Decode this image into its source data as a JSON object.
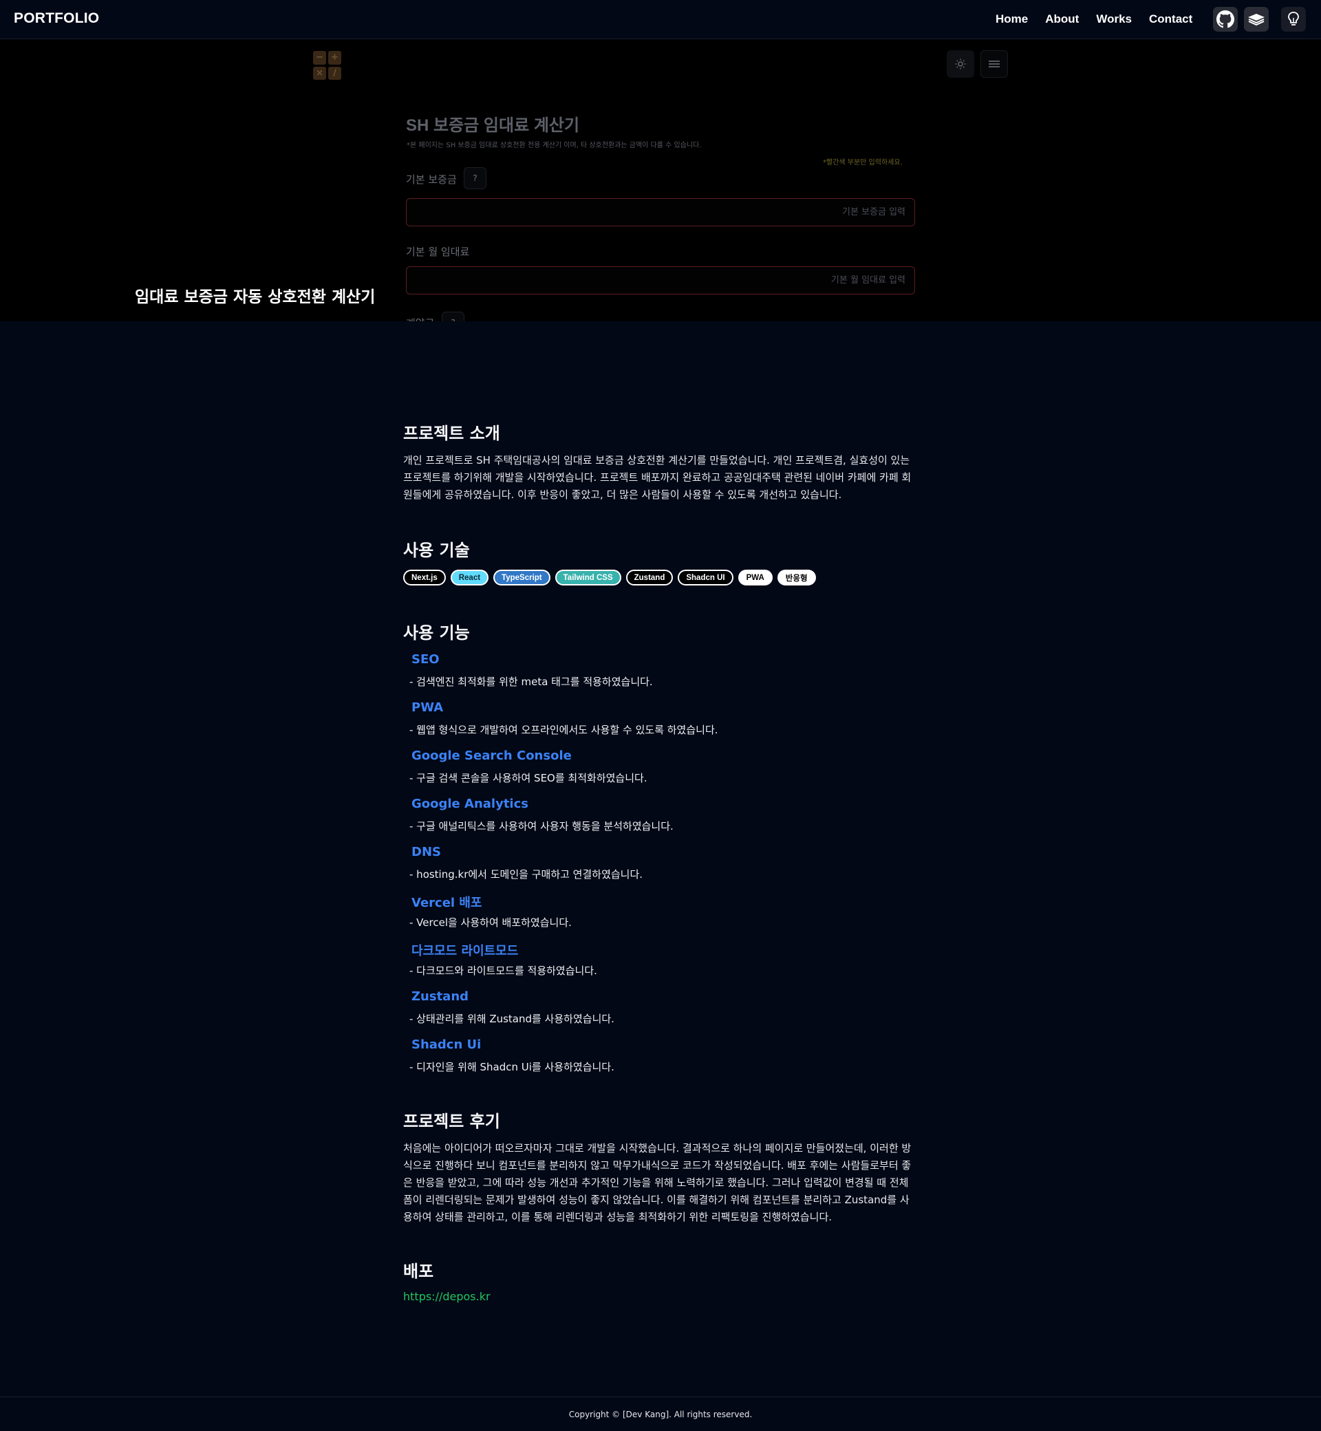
{
  "nav": {
    "logo": "PORTFOLIO",
    "links": [
      "Home",
      "About",
      "Works",
      "Contact"
    ],
    "icons": [
      "github-icon",
      "book-icon",
      "lightbulb-icon"
    ]
  },
  "hero": {
    "title": "임대료 보증금 자동 상호전환 계산기",
    "calc": {
      "title": "SH 보증금 임대료 계산기",
      "note": "*본 페이지는 SH 보증금 임대료 상호전환 전용 계산기 이며, 타 상호전환과는 금액이 다를 수 있습니다.",
      "red_note": "*빨간색 부분만 입력하세요.",
      "deposit_label": "기본 보증금",
      "deposit_help": "?",
      "deposit_placeholder": "기본 보증금 입력",
      "rent_label": "기본 월 임대료",
      "rent_placeholder": "기본 월 임대료 입력",
      "contract_label": "계약금",
      "contract_help": "?"
    }
  },
  "intro": {
    "heading": "프로젝트 소개",
    "text": "개인 프로젝트로 SH 주택임대공사의 임대료 보증금 상호전환 계산기를 만들었습니다. 개인 프로젝트겸, 실효성이 있는 프로젝트를 하기위해 개발을 시작하였습니다. 프로젝트 배포까지 완료하고 공공임대주택 관련된 네이버 카페에 카페 회원들에게 공유하였습니다. 이후 반응이 좋았고, 더 많은 사람들이 사용할 수 있도록 개선하고 있습니다."
  },
  "tech": {
    "heading": "사용 기술",
    "tags": [
      {
        "label": "Next.js",
        "bg": "#000000",
        "fg": "#ffffff",
        "border": "#ffffff"
      },
      {
        "label": "React",
        "bg": "#61dafb",
        "fg": "#0a2a36",
        "border": "#ffffff"
      },
      {
        "label": "TypeScript",
        "bg": "#3178c6",
        "fg": "#ffffff",
        "border": "#ffffff"
      },
      {
        "label": "Tailwind CSS",
        "bg": "#38b2ac",
        "fg": "#ffffff",
        "border": "#ffffff"
      },
      {
        "label": "Zustand",
        "bg": "#000000",
        "fg": "#ffffff",
        "border": "#ffffff"
      },
      {
        "label": "Shadcn UI",
        "bg": "#000000",
        "fg": "#ffffff",
        "border": "#ffffff"
      },
      {
        "label": "PWA",
        "bg": "#ffffff",
        "fg": "#000000",
        "border": "#ffffff"
      },
      {
        "label": "반응형",
        "bg": "#ffffff",
        "fg": "#000000",
        "border": "#ffffff"
      }
    ]
  },
  "features": {
    "heading": "사용 기능",
    "items": [
      {
        "title": "SEO",
        "desc": "-  검색엔진 최적화를 위한 meta 태그를 적용하였습니다."
      },
      {
        "title": "PWA",
        "desc": "-  웹앱 형식으로 개발하여 오프라인에서도 사용할 수 있도록 하였습니다."
      },
      {
        "title": "Google Search Console",
        "desc": "-  구글 검색 콘솔을 사용하여 SEO를 최적화하였습니다."
      },
      {
        "title": "Google Analytics",
        "desc": "-  구글 애널리틱스를 사용하여 사용자 행동을 분석하였습니다."
      },
      {
        "title": "DNS",
        "desc": "-  hosting.kr에서 도메인을 구매하고 연결하였습니다."
      },
      {
        "title": "Vercel 배포",
        "desc": "-  Vercel을 사용하여 배포하였습니다."
      },
      {
        "title": "다크모드 라이트모드",
        "desc": "-  다크모드와 라이트모드를 적용하였습니다."
      },
      {
        "title": "Zustand",
        "desc": "-  상태관리를 위해 Zustand를 사용하였습니다."
      },
      {
        "title": "Shadcn Ui",
        "desc": "-  디자인을 위해 Shadcn Ui를 사용하였습니다."
      }
    ]
  },
  "review": {
    "heading": "프로젝트 후기",
    "text": "처음에는 아이디어가 떠오르자마자 그대로 개발을 시작했습니다. 결과적으로 하나의 페이지로 만들어졌는데, 이러한 방식으로 진행하다 보니 컴포넌트를 분리하지 않고 막무가내식으로 코드가 작성되었습니다. 배포 후에는 사람들로부터 좋은 반응을 받았고, 그에 따라 성능 개선과 추가적인 기능을 위해 노력하기로 했습니다. 그러나 입력값이 변경될 때 전체 폼이 리렌더링되는 문제가 발생하여 성능이 좋지 않았습니다. 이를 해결하기 위해 컴포넌트를 분리하고 Zustand를 사용하여 상태를 관리하고, 이를 통해 리렌더링과 성능을 최적화하기 위한 리팩토링을 진행하였습니다."
  },
  "deploy": {
    "heading": "배포",
    "url": "https://depos.kr"
  },
  "footer": {
    "copyright": "Copyright © [Dev Kang]. All rights reserved."
  }
}
